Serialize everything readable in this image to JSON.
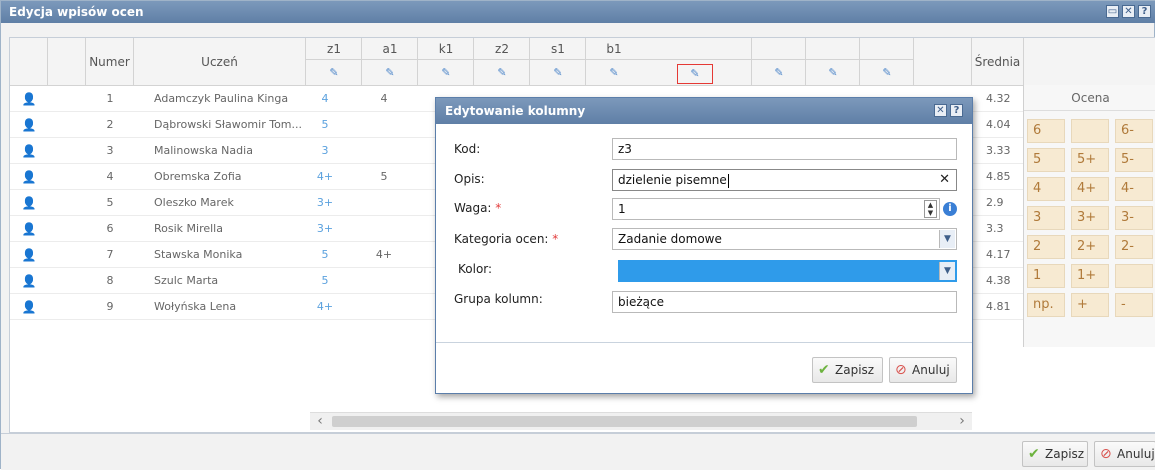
{
  "window": {
    "title": "Edycja wpisów ocen"
  },
  "colors": {
    "accent": "#5f7fa6",
    "highlight_border": "#e53935",
    "color_field": "#2f9bea"
  },
  "table": {
    "headers": {
      "numer": "Numer",
      "uczen": "Uczeń",
      "srednia": "Średnia"
    },
    "grade_columns": [
      "z1",
      "a1",
      "k1",
      "z2",
      "s1",
      "b1"
    ],
    "rows": [
      {
        "num": "1",
        "name": "Adamczyk Paulina Kinga",
        "z1": "4",
        "a1": "4",
        "avg": "4.32"
      },
      {
        "num": "2",
        "name": "Dąbrowski Sławomir Tom...",
        "z1": "5",
        "a1": "",
        "avg": "4.04"
      },
      {
        "num": "3",
        "name": "Malinowska Nadia",
        "z1": "3",
        "a1": "",
        "avg": "3.33"
      },
      {
        "num": "4",
        "name": "Obremska Zofia",
        "z1": "4+",
        "a1": "5",
        "avg": "4.85"
      },
      {
        "num": "5",
        "name": "Oleszko Marek",
        "z1": "3+",
        "a1": "",
        "avg": "2.9"
      },
      {
        "num": "6",
        "name": "Rosik Mirella",
        "z1": "3+",
        "a1": "",
        "avg": "3.3"
      },
      {
        "num": "7",
        "name": "Stawska Monika",
        "z1": "5",
        "a1": "4+",
        "avg": "4.17"
      },
      {
        "num": "8",
        "name": "Szulc Marta",
        "z1": "5",
        "a1": "",
        "avg": "4.38"
      },
      {
        "num": "9",
        "name": "Wołyńska Lena",
        "z1": "4+",
        "a1": "",
        "avg": "4.81"
      }
    ]
  },
  "ocena": {
    "title": "Ocena",
    "grid": [
      [
        "6",
        "",
        "6-"
      ],
      [
        "5",
        "5+",
        "5-"
      ],
      [
        "4",
        "4+",
        "4-"
      ],
      [
        "3",
        "3+",
        "3-"
      ],
      [
        "2",
        "2+",
        "2-"
      ],
      [
        "1",
        "1+",
        ""
      ],
      [
        "np.",
        "+",
        "-"
      ]
    ]
  },
  "dialog": {
    "title": "Edytowanie kolumny",
    "kod_label": "Kod:",
    "kod_value": "z3",
    "opis_label": "Opis:",
    "opis_value": "dzielenie pisemne",
    "waga_label": "Waga:",
    "waga_value": "1",
    "kategoria_label": "Kategoria ocen:",
    "kategoria_value": "Zadanie domowe",
    "kolor_label": "Kolor:",
    "grupa_label": "Grupa kolumn:",
    "grupa_value": "bieżące",
    "save_label": "Zapisz",
    "cancel_label": "Anuluj",
    "required_mark": "*"
  },
  "footer": {
    "save_label": "Zapisz",
    "cancel_label": "Anuluj"
  }
}
